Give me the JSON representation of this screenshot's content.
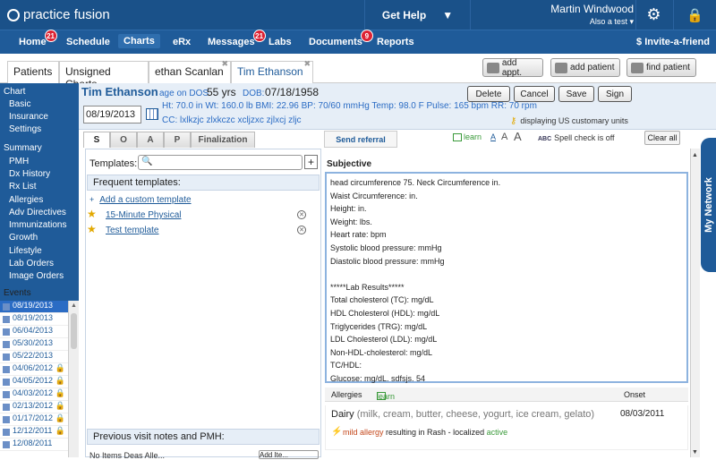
{
  "app": {
    "logo": "practice fusion",
    "get_help": "Get Help",
    "user_name": "Martin Windwood",
    "user_role": "Also a test"
  },
  "nav": {
    "home": "Home",
    "home_badge": "21",
    "schedule": "Schedule",
    "charts": "Charts",
    "erx": "eRx",
    "messages": "Messages",
    "messages_badge": "21",
    "labs": "Labs",
    "documents": "Documents",
    "documents_badge": "9",
    "reports": "Reports",
    "invite": "Invite-a-friend"
  },
  "tabs": {
    "patients": "Patients",
    "unsigned": "Unsigned Charts",
    "ethan": "ethan Scanlan",
    "tim": "Tim Ethanson",
    "add_appt": "add appt.",
    "add_patient": "add patient",
    "find_patient": "find patient"
  },
  "sidebar": {
    "chart": "Chart",
    "basic": "Basic",
    "insurance": "Insurance",
    "settings": "Settings",
    "summary": "Summary",
    "pmh": "PMH",
    "dx_history": "Dx History",
    "rx_list": "Rx List",
    "allergies": "Allergies",
    "adv_directives": "Adv Directives",
    "immunizations": "Immunizations",
    "growth": "Growth",
    "lifestyle": "Lifestyle",
    "lab_orders": "Lab Orders",
    "image_orders": "Image Orders",
    "events": "Events"
  },
  "events": [
    {
      "date": "08/19/2013",
      "locked": false
    },
    {
      "date": "08/19/2013",
      "locked": false
    },
    {
      "date": "06/04/2013",
      "locked": false
    },
    {
      "date": "05/30/2013",
      "locked": false
    },
    {
      "date": "05/22/2013",
      "locked": false
    },
    {
      "date": "04/06/2012",
      "locked": true
    },
    {
      "date": "04/05/2012",
      "locked": true
    },
    {
      "date": "04/03/2012",
      "locked": true
    },
    {
      "date": "02/13/2012",
      "locked": true
    },
    {
      "date": "01/17/2012",
      "locked": true
    },
    {
      "date": "12/12/2011",
      "locked": true
    },
    {
      "date": "12/08/2011",
      "locked": false
    }
  ],
  "patient": {
    "name": "Tim Ethanson",
    "age_label": "age on DOS",
    "age": "55 yrs",
    "dob_label": "DOB:",
    "dob": "07/18/1958",
    "visit_date": "08/19/2013",
    "vitals": "Ht: 70.0 in   Wt: 160.0 lb   BMI: 22.96   BP: 70/60 mmHg   Temp: 98.0 F   Pulse: 165 bpm   RR: 70 rpm",
    "cc": "CC: lxlkzjc zlxkczc xcljzxc zjlxcj zljc",
    "units": "displaying US customary units"
  },
  "actions": {
    "delete": "Delete",
    "cancel": "Cancel",
    "save": "Save",
    "sign": "Sign"
  },
  "soap_tabs": {
    "s": "S",
    "o": "O",
    "a": "A",
    "p": "P",
    "finalization": "Finalization"
  },
  "toolbar": {
    "send_referral": "Send referral",
    "learn": "learn",
    "font_a": "A",
    "spell": "Spell check is off",
    "spell_icon": "ABC",
    "clear_all": "Clear all"
  },
  "templates": {
    "label": "Templates:",
    "search_placeholder": "",
    "frequent": "Frequent templates:",
    "add_custom": "Add a custom template",
    "items": [
      "15-Minute Physical",
      "Test template"
    ],
    "prev_visit": "Previous visit notes and PMH:",
    "cut_left": "No Items Deas Alle...",
    "cut_btn": "Add Ite..."
  },
  "subjective": {
    "heading": "Subjective",
    "lines": [
      "head circumference 75.  Neck Circumference  in.",
      "Waist Circumference:  in.",
      "Height:  in.",
      "Weight:  lbs.",
      "Heart rate:  bpm",
      "Systolic blood pressure:  mmHg",
      "Diastolic blood pressure:  mmHg",
      "",
      "*****Lab Results*****",
      "Total cholesterol (TC):  mg/dL",
      "HDL Cholesterol (HDL):  mg/dL",
      "Triglycerides (TRG):  mg/dL",
      "LDL Cholesterol (LDL):  mg/dL",
      "Non-HDL-cholesterol:  mg/dL",
      "TC/HDL:",
      "Glucose:  mg/dL.  sdfsjs.  54"
    ]
  },
  "allergies": {
    "heading": "Allergies",
    "learn": "learn",
    "onset": "Onset",
    "name": "Dairy",
    "detail": "(milk, cream, butter, cheese, yogurt, ice cream, gelato)",
    "date": "08/03/2011",
    "severity": "mild allergy",
    "result_text": "resulting in Rash - localized",
    "status": "active"
  },
  "mynetwork": "My Network",
  "colors": {
    "brand": "#1f5b99",
    "topbar": "#1a5189",
    "badge": "#dd2233",
    "active": "#3a9a3a",
    "severity": "#c4471b"
  }
}
